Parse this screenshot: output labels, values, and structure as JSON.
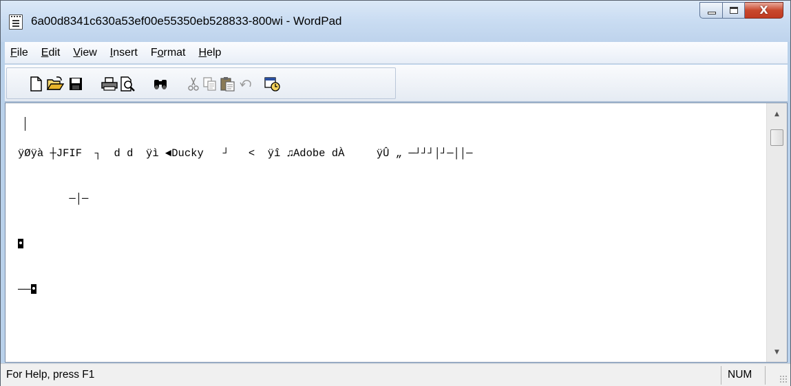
{
  "window": {
    "title": "6a00d8341c630a53ef00e55350eb528833-800wi - WordPad",
    "app_icon": "wordpad-icon",
    "controls": {
      "minimize": "minimize-icon",
      "maximize": "maximize-icon",
      "close": "close-icon",
      "close_glyph": "X"
    }
  },
  "menubar": {
    "items": [
      {
        "label_prefix": "",
        "accel": "F",
        "label_rest": "ile"
      },
      {
        "label_prefix": "",
        "accel": "E",
        "label_rest": "dit"
      },
      {
        "label_prefix": "",
        "accel": "V",
        "label_rest": "iew"
      },
      {
        "label_prefix": "",
        "accel": "I",
        "label_rest": "nsert"
      },
      {
        "label_prefix": "F",
        "accel": "o",
        "label_rest": "rmat"
      },
      {
        "label_prefix": "",
        "accel": "H",
        "label_rest": "elp"
      }
    ]
  },
  "toolbar": {
    "buttons": [
      "new-icon",
      "open-icon",
      "save-icon",
      "print-icon",
      "print-preview-icon",
      "find-icon",
      "cut-icon",
      "copy-icon",
      "paste-icon",
      "undo-icon",
      "date-time-icon"
    ]
  },
  "document": {
    "line1": "ÿØÿà ┼JFIF  ┐  d d  ÿì ◄Ducky   ┘   <  ÿî ♫Adobe dÀ     ÿÛ „ ─┘┘┘│┘─││─",
    "line2": "        ─│─",
    "line4_prefix": "──"
  },
  "statusbar": {
    "help_text": "For Help, press F1",
    "num_indicator": "NUM"
  },
  "colors": {
    "frame": "#b9d1ea",
    "close_button": "#c8482d"
  }
}
